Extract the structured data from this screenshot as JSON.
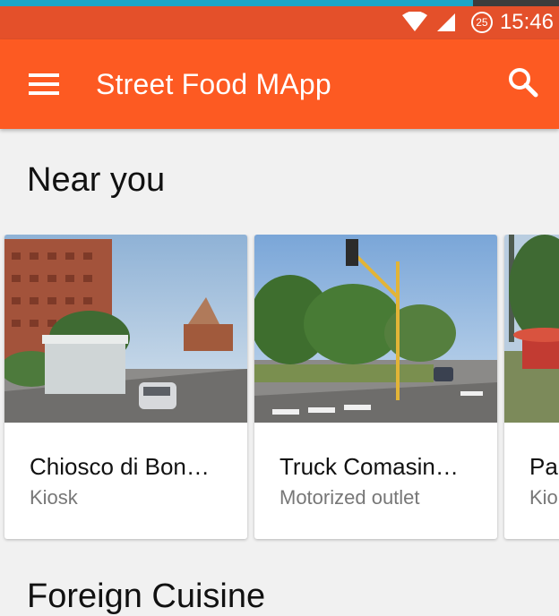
{
  "status_bar": {
    "time": "15:46",
    "notification_count": "25"
  },
  "app_bar": {
    "title": "Street Food MApp"
  },
  "sections": [
    {
      "title": "Near you"
    },
    {
      "title": "Foreign Cuisine"
    }
  ],
  "near_you": [
    {
      "name": "Chiosco di Bon…",
      "type": "Kiosk"
    },
    {
      "name": "Truck Comasin…",
      "type": "Motorized outlet"
    },
    {
      "name": "Par",
      "type": "Kio"
    }
  ],
  "colors": {
    "app_bar": "#fd5a22",
    "status_bar": "#e4502a",
    "background": "#f1f1f1"
  }
}
